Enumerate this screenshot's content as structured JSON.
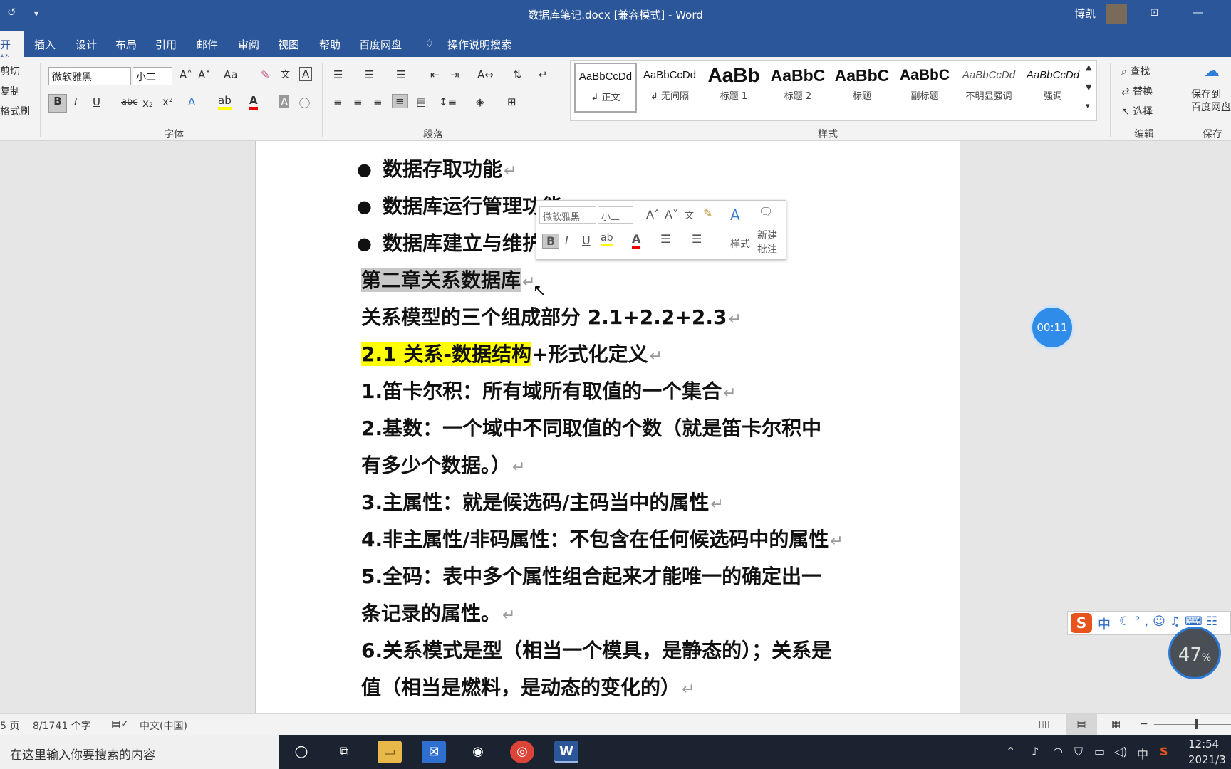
{
  "titlebar": {
    "title": "数据库笔记.docx [兼容模式]  -  Word",
    "user": "博凯",
    "icons": [
      "refresh-icon",
      "customize-icon",
      "ribbon-display-icon",
      "minimize-icon"
    ]
  },
  "tabs": [
    "开始",
    "插入",
    "设计",
    "布局",
    "引用",
    "邮件",
    "审阅",
    "视图",
    "帮助",
    "百度网盘",
    "操作说明搜索"
  ],
  "clipboard": {
    "cut": "剪切",
    "copy": "复制",
    "format_painter": "格式刷"
  },
  "font": {
    "name": "微软雅黑",
    "size": "小二",
    "group_label": "字体",
    "change_case": "Aa",
    "bold": "B",
    "italic": "I",
    "underline": "U",
    "strike": "abc",
    "sub": "x₂",
    "sup": "x²",
    "font_color": "A"
  },
  "paragraph": {
    "group_label": "段落"
  },
  "styles": {
    "group_label": "样式",
    "items": [
      {
        "preview": "AaBbCcDd",
        "label": "↲ 正文"
      },
      {
        "preview": "AaBbCcDd",
        "label": "↲ 无间隔"
      },
      {
        "preview": "AaBb",
        "label": "标题 1"
      },
      {
        "preview": "AaBbC",
        "label": "标题 2"
      },
      {
        "preview": "AaBbC",
        "label": "标题"
      },
      {
        "preview": "AaBbC",
        "label": "副标题"
      },
      {
        "preview": "AaBbCcDd",
        "label": "不明显强调"
      },
      {
        "preview": "AaBbCcDd",
        "label": "强调"
      }
    ]
  },
  "editing": {
    "find": "查找",
    "replace": "替换",
    "select": "选择",
    "group_label": "编辑"
  },
  "save": {
    "label1": "保存到",
    "label2": "百度网盘",
    "group_label": "保存"
  },
  "mini_toolbar": {
    "font": "微软雅黑",
    "size": "小二",
    "styles": "样式",
    "new_comment1": "新建",
    "new_comment2": "批注",
    "bold": "B",
    "italic": "I",
    "underline": "U"
  },
  "document": {
    "lines": [
      {
        "text": "数据存取功能",
        "pm": "↵"
      },
      {
        "text": "数据库运行管理功能",
        "pm": "↵"
      },
      {
        "text": "数据库建立与维护的功能。",
        "pm": ""
      },
      {
        "text": "第二章关系数据库",
        "pm": "↵"
      },
      {
        "text": "关系模型的三个组成部分 2.1+2.2+2.3",
        "pm": "↵"
      },
      {
        "text_hl": "2.1 关系-数据结构",
        "text": "+形式化定义",
        "pm": "↵"
      },
      {
        "text": "1.笛卡尔积：所有域所有取值的一个集合",
        "pm": "↵"
      },
      {
        "text": "2.基数：一个域中不同取值的个数（就是笛卡尔积中",
        "pm": ""
      },
      {
        "text": "有多少个数据。）",
        "pm": "↵"
      },
      {
        "text": "3.主属性：就是候选码/主码当中的属性",
        "pm": "↵"
      },
      {
        "text": "4.非主属性/非码属性：不包含在任何候选码中的属性",
        "pm": "↵"
      },
      {
        "text": "5.全码：表中多个属性组合起来才能唯一的确定出一",
        "pm": ""
      },
      {
        "text": "条记录的属性。",
        "pm": "↵"
      },
      {
        "text": "6.关系模式是型（相当一个模具，是静态的）；关系是",
        "pm": ""
      },
      {
        "text": "值（相当是燃料，是动态的变化的）",
        "pm": "↵"
      }
    ]
  },
  "overlay": {
    "timer": "00:11",
    "ime_cn": "中",
    "battery_pct": "47",
    "battery_unit": "%"
  },
  "statusbar": {
    "page": "5 页",
    "words": "8/1741 个字",
    "language": "中文(中国)"
  },
  "taskbar": {
    "search_placeholder": "在这里输入你要搜索的内容",
    "tray_ime": "中",
    "time": "12:54",
    "date": "2021/3"
  }
}
